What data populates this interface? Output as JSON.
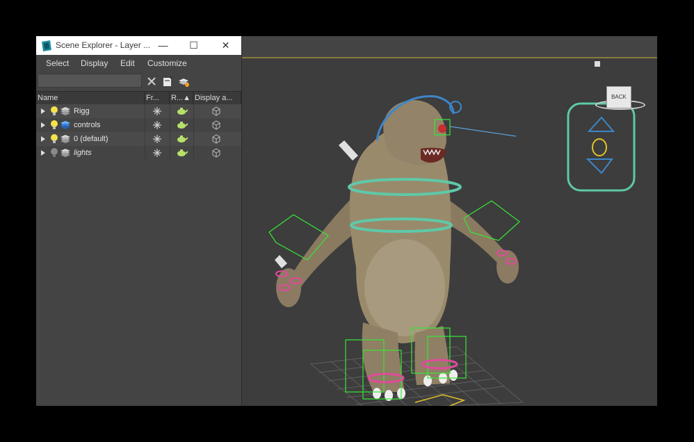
{
  "window": {
    "title": "Scene Explorer - Layer ...",
    "minimize": "—",
    "maximize": "☐",
    "close": "✕"
  },
  "menu": [
    "Select",
    "Display",
    "Edit",
    "Customize"
  ],
  "search": {
    "value": "",
    "placeholder": ""
  },
  "columns": [
    "Name",
    "Fr...",
    "R...▲",
    "Display a..."
  ],
  "layers": [
    {
      "name": "Rigg",
      "bulb": "on",
      "icon": "layer-stack-gray",
      "italic": false
    },
    {
      "name": "controls",
      "bulb": "on",
      "icon": "layer-stack-blue",
      "italic": false
    },
    {
      "name": "0 (default)",
      "bulb": "on",
      "icon": "layer-stack-gray",
      "italic": false
    },
    {
      "name": "lights",
      "bulb": "off",
      "icon": "layer-stack-gray",
      "italic": true
    }
  ],
  "viewcube": {
    "face_label": "BACK"
  },
  "colors": {
    "rig_green": "#35e835",
    "ring_teal": "#5ec9a8",
    "ring_pink": "#e04a9a",
    "spline_blue": "#3e86c8",
    "panel_bg": "#444444",
    "viewport_bg": "#3d3d3d"
  }
}
